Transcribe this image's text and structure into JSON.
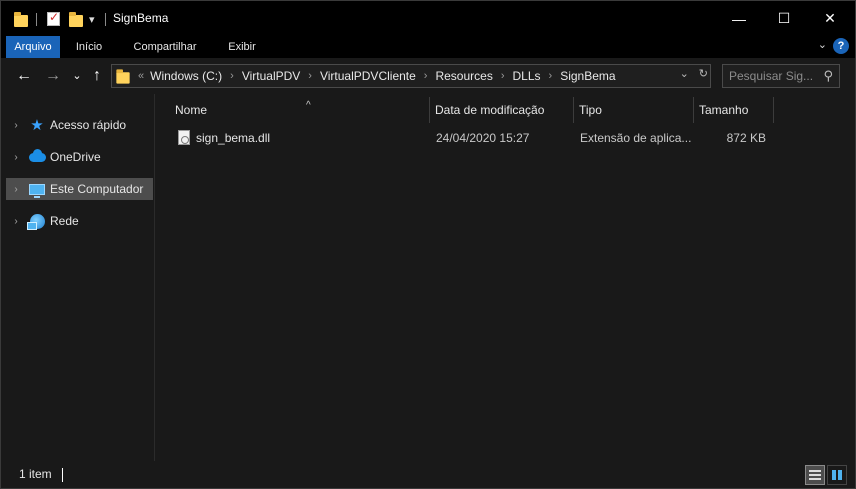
{
  "window": {
    "title": "SignBema",
    "controls": {
      "minimize": "—",
      "maximize": "☐",
      "close": "✕"
    }
  },
  "ribbon": {
    "tabs": [
      {
        "label": "Arquivo",
        "active": true
      },
      {
        "label": "Início"
      },
      {
        "label": "Compartilhar"
      },
      {
        "label": "Exibir"
      }
    ],
    "expand_glyph": "⌄",
    "help_glyph": "?"
  },
  "navbar": {
    "back_glyph": "←",
    "forward_glyph": "→",
    "recent_glyph": "⌄",
    "up_glyph": "↑",
    "address_prefix": "«",
    "breadcrumb": [
      "Windows (C:)",
      "VirtualPDV",
      "VirtualPDVCliente",
      "Resources",
      "DLLs",
      "SignBema"
    ],
    "separator": "›",
    "dropdown_glyph": "⌄",
    "refresh_glyph": "↻",
    "search_placeholder": "Pesquisar Sig...",
    "search_glyph": "⚲"
  },
  "sidebar": {
    "items": [
      {
        "label": "Acesso rápido",
        "icon": "star-icon",
        "chevron": "›"
      },
      {
        "label": "OneDrive",
        "icon": "cloud-icon",
        "chevron": "›"
      },
      {
        "label": "Este Computador",
        "icon": "computer-icon",
        "chevron": "›",
        "selected": true
      },
      {
        "label": "Rede",
        "icon": "network-icon",
        "chevron": "›"
      }
    ]
  },
  "file_list": {
    "sort_glyph": "^",
    "columns": {
      "name": "Nome",
      "date": "Data de modificação",
      "type": "Tipo",
      "size": "Tamanho"
    },
    "rows": [
      {
        "name": "sign_bema.dll",
        "date": "24/04/2020 15:27",
        "type": "Extensão de aplica...",
        "size": "872 KB",
        "icon": "dll-file-icon"
      }
    ]
  },
  "statusbar": {
    "item_count": "1 item"
  }
}
